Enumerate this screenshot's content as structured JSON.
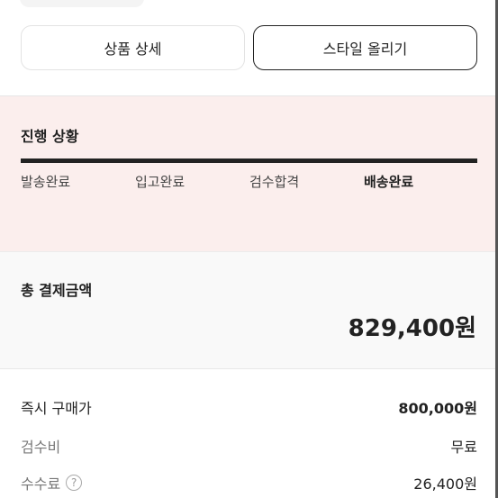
{
  "tabs": {
    "product_detail": "상품 상세",
    "post_style": "스타일 올리기"
  },
  "progress": {
    "title": "진행 상황",
    "steps": [
      "발송완료",
      "입고완료",
      "검수합격",
      "배송완료"
    ],
    "current_step": "배송완료"
  },
  "payment": {
    "total_label": "총 결제금액",
    "total_value": "829,400원",
    "rows": [
      {
        "label": "즉시 구매가",
        "value": "800,000원"
      },
      {
        "label": "검수비",
        "value": "무료"
      },
      {
        "label": "수수료",
        "value": "26,400원",
        "help_icon": "?"
      }
    ]
  }
}
